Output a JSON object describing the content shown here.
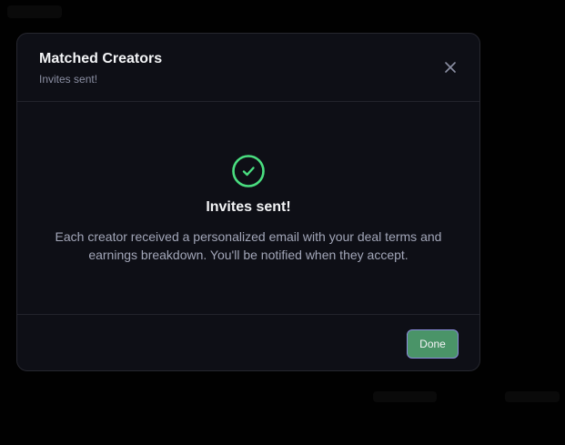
{
  "modal": {
    "title": "Matched Creators",
    "subtitle": "Invites sent!",
    "close_icon": "close-icon"
  },
  "body": {
    "icon": "check-circle-icon",
    "heading": "Invites sent!",
    "message": "Each creator received a personalized email with your deal terms and earnings breakdown. You'll be notified when they accept."
  },
  "footer": {
    "done_label": "Done"
  },
  "colors": {
    "success": "#4ade80",
    "button_bg": "#4a9468",
    "button_border": "#8a8bdc",
    "modal_bg": "#0e0f16"
  }
}
